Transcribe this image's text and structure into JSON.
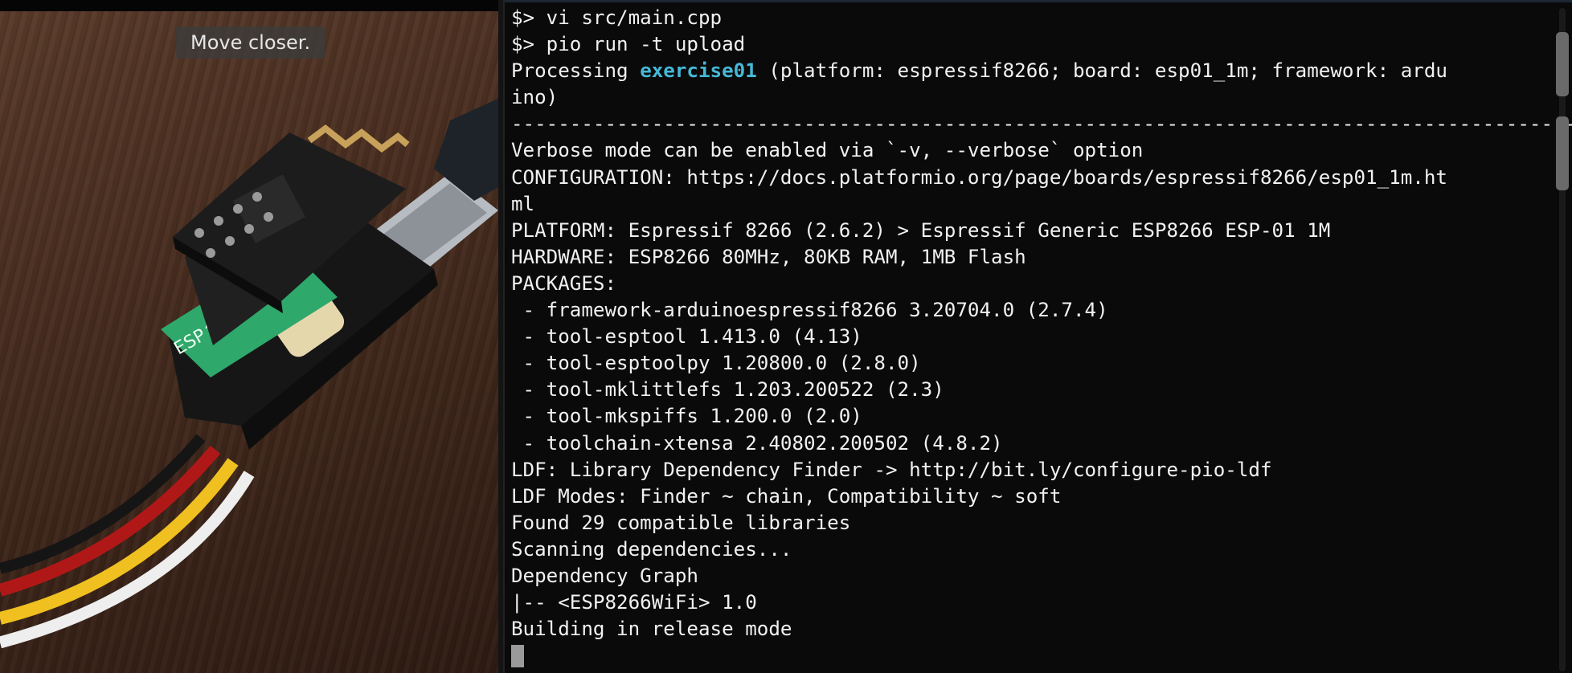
{
  "camera": {
    "hint": "Move closer."
  },
  "terminal": {
    "lines": [
      {
        "text": "$> vi src/main.cpp"
      },
      {
        "text": "$> pio run -t upload"
      },
      {
        "pre": "Processing ",
        "hl": "exercise01",
        "post": " (platform: espressif8266; board: esp01_1m; framework: ardu"
      },
      {
        "text": "ino)"
      },
      {
        "text": "------------------------------------------------------------------------------------------------------------------------"
      },
      {
        "text": "Verbose mode can be enabled via `-v, --verbose` option"
      },
      {
        "text": "CONFIGURATION: https://docs.platformio.org/page/boards/espressif8266/esp01_1m.ht"
      },
      {
        "text": "ml"
      },
      {
        "text": "PLATFORM: Espressif 8266 (2.6.2) > Espressif Generic ESP8266 ESP-01 1M"
      },
      {
        "text": "HARDWARE: ESP8266 80MHz, 80KB RAM, 1MB Flash"
      },
      {
        "text": "PACKAGES:"
      },
      {
        "text": " - framework-arduinoespressif8266 3.20704.0 (2.7.4)"
      },
      {
        "text": " - tool-esptool 1.413.0 (4.13)"
      },
      {
        "text": " - tool-esptoolpy 1.20800.0 (2.8.0)"
      },
      {
        "text": " - tool-mklittlefs 1.203.200522 (2.3)"
      },
      {
        "text": " - tool-mkspiffs 1.200.0 (2.0)"
      },
      {
        "text": " - toolchain-xtensa 2.40802.200502 (4.8.2)"
      },
      {
        "text": "LDF: Library Dependency Finder -> http://bit.ly/configure-pio-ldf"
      },
      {
        "text": "LDF Modes: Finder ~ chain, Compatibility ~ soft"
      },
      {
        "text": "Found 29 compatible libraries"
      },
      {
        "text": "Scanning dependencies..."
      },
      {
        "text": "Dependency Graph"
      },
      {
        "text": "|-- <ESP8266WiFi> 1.0"
      },
      {
        "text": "Building in release mode"
      }
    ],
    "colors": {
      "background": "#0a0a0b",
      "text": "#f1f1f1",
      "highlight": "#46b8d6"
    }
  }
}
